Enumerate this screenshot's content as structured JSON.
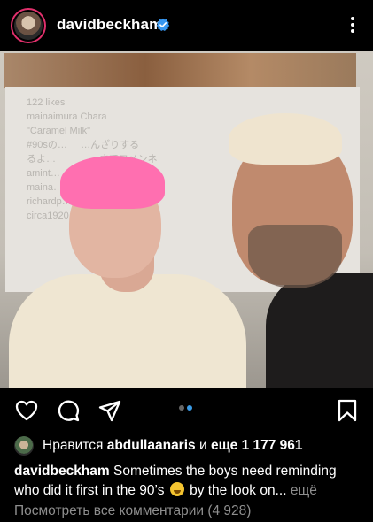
{
  "header": {
    "username": "davidbeckham",
    "verified_color": "#3897f0",
    "avatar_icon": "profile-avatar",
    "more_icon": "more-vertical-icon"
  },
  "photo": {
    "poster_lines": [
      "122 likes",
      "mainaimura Chara",
      "\"Caramel Milk\"",
      "#90sの…     …んざりする",
      "るよ…                さてコメンネ",
      "amint…",
      "maina…           onlinecom kaw",
      "richardp…       nt Toy Hardwar",
      "circa1920…"
    ]
  },
  "actions": {
    "like_icon": "heart-icon",
    "comment_icon": "comment-icon",
    "share_icon": "send-icon",
    "save_icon": "bookmark-icon",
    "carousel": {
      "count": 2,
      "active_index": 1,
      "active_color": "#3a9be6"
    }
  },
  "likes": {
    "prefix": "Нравится",
    "user": "abdullaanaris",
    "joiner": "и",
    "rest": "еще 1 177 961"
  },
  "caption": {
    "username": "davidbeckham",
    "text_before_emoji": "Sometimes the boys need reminding who did it first in the 90’s",
    "text_after_emoji": "by the look on...",
    "more": "ещё"
  },
  "comments_link": "Посмотреть все комментарии (4 928)"
}
